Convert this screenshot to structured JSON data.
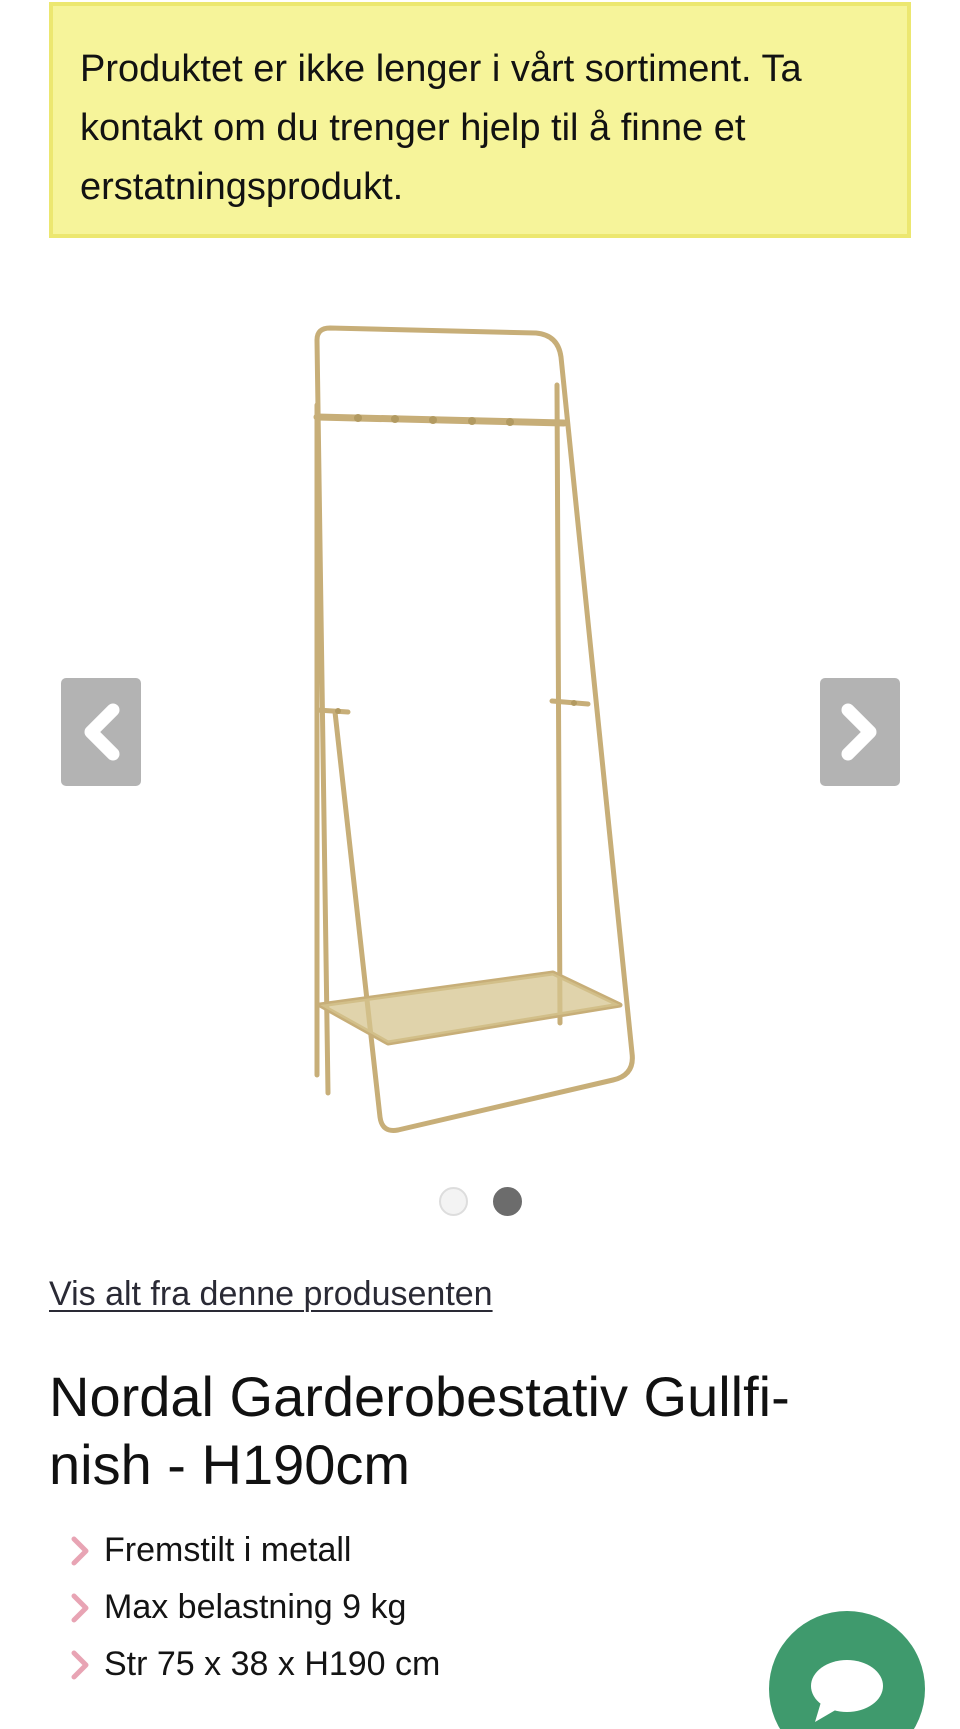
{
  "notice": {
    "text": "Produktet er ikke lenger i vårt sortiment. Ta kontakt om du trenger hjelp til å finne et erstatningsprodukt."
  },
  "gallery": {
    "image_alt": "Nordal Garderobestativ Gullfinish",
    "image_icon": "gold-clothes-rack-image",
    "prev_icon": "chevron-left-icon",
    "next_icon": "chevron-right-icon",
    "slide_count": 2,
    "active_slide": 2
  },
  "product": {
    "brand_link": "Vis alt fra denne produsenten",
    "title": "Nordal Garderobestativ Gullfi-nish - H190cm",
    "features": [
      "Fremstilt i metall",
      "Max belastning 9 kg",
      "Str 75 x 38 x H190 cm"
    ]
  },
  "chat": {
    "icon": "chat-bubble-icon"
  },
  "colors": {
    "notice_bg": "#f6f49a",
    "notice_border": "#ece770",
    "nav_button": "#b3b3b3",
    "feature_chevron": "#e8a4b4",
    "chat_button": "#3f9a6d",
    "rack_gold": "#c7ae78"
  }
}
